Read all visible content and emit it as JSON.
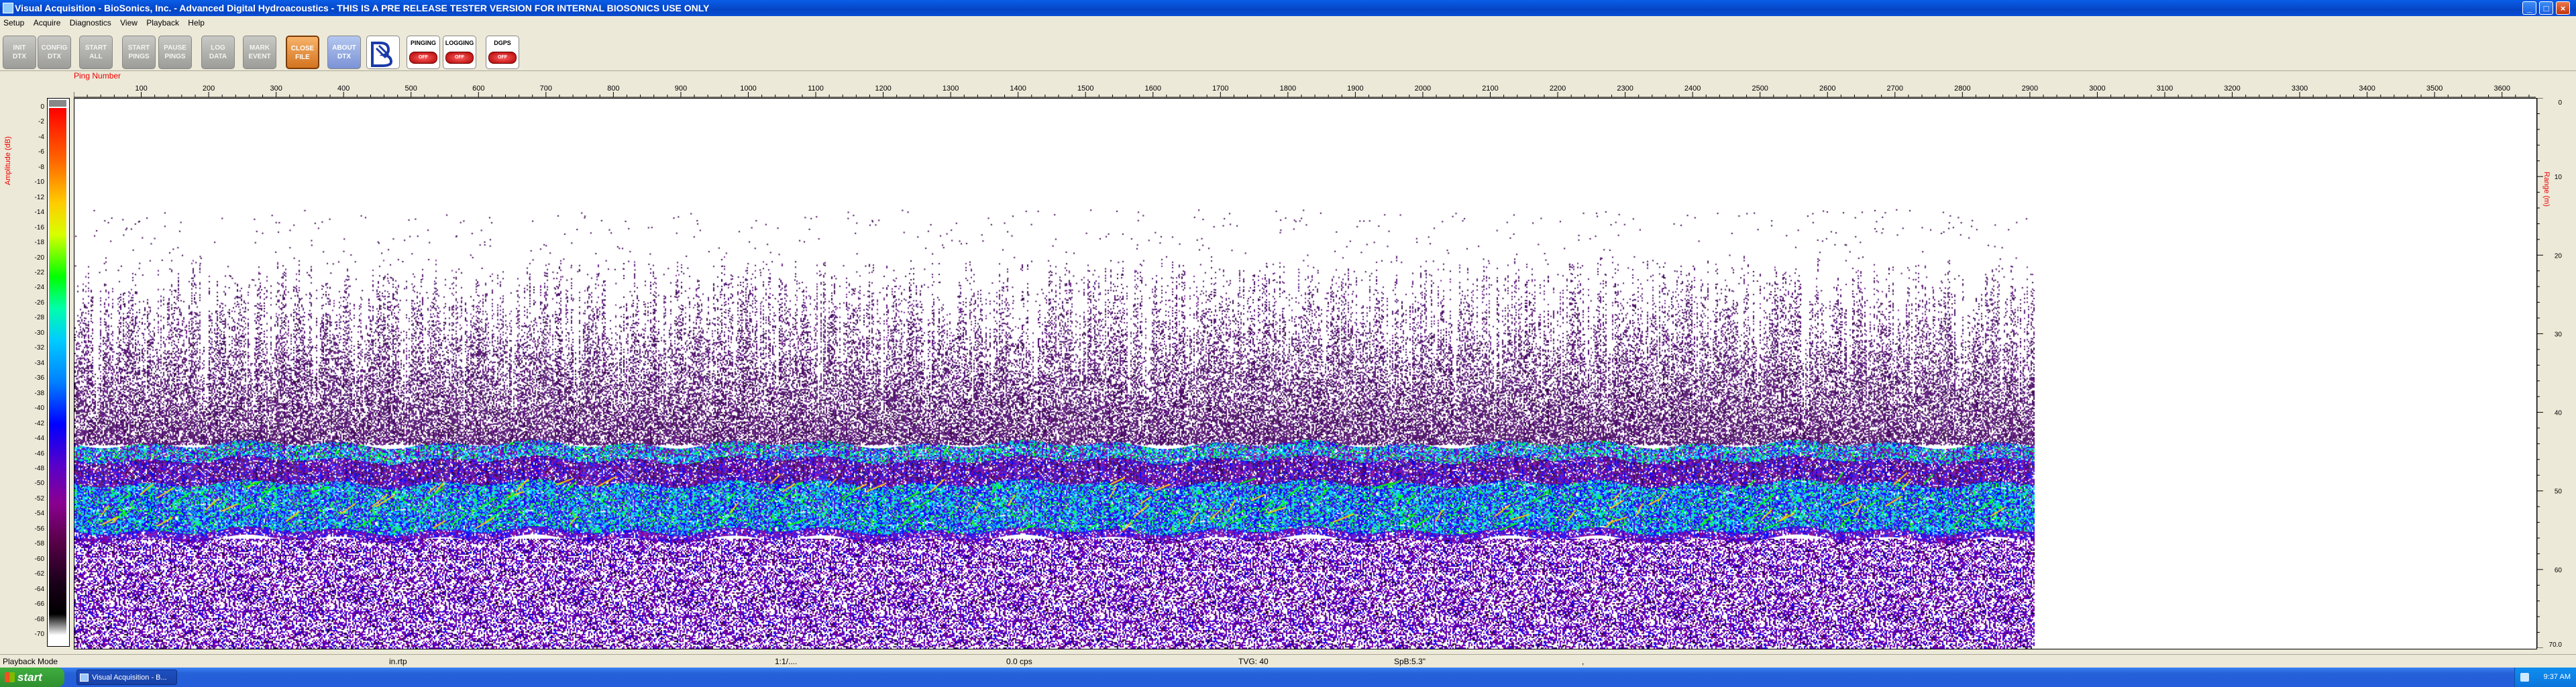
{
  "window": {
    "title": "Visual Acquisition  -  BioSonics, Inc.  -  Advanced Digital Hydroacoustics  -  THIS IS A PRE RELEASE TESTER VERSION FOR INTERNAL BIOSONICS USE ONLY",
    "minimize_icon": "minimize-icon",
    "maximize_icon": "maximize-icon",
    "close_icon": "close-icon"
  },
  "menu": [
    "Setup",
    "Acquire",
    "Diagnostics",
    "View",
    "Playback",
    "Help"
  ],
  "toolbar": {
    "buttons": [
      {
        "line1": "INIT",
        "line2": "DTX"
      },
      {
        "line1": "CONFIG",
        "line2": "DTX"
      },
      {
        "line1": "START",
        "line2": "ALL"
      },
      {
        "line1": "START",
        "line2": "PINGS"
      },
      {
        "line1": "PAUSE",
        "line2": "PINGS"
      },
      {
        "line1": "LOG",
        "line2": "DATA"
      },
      {
        "line1": "MARK",
        "line2": "EVENT"
      },
      {
        "line1": "CLOSE",
        "line2": "FILE"
      },
      {
        "line1": "ABOUT",
        "line2": "DTX"
      }
    ],
    "status": [
      {
        "label": "PINGING",
        "state": "OFF"
      },
      {
        "label": "LOGGING",
        "state": "OFF"
      },
      {
        "label": "DGPS",
        "state": "OFF"
      }
    ]
  },
  "echogram": {
    "amplitude_label": "Amplitude (dB)",
    "range_label": "Range (m)",
    "ping_label": "Ping Number",
    "amplitude_ticks": [
      "0",
      "-2",
      "-4",
      "-6",
      "-8",
      "-10",
      "-12",
      "-14",
      "-16",
      "-18",
      "-20",
      "-22",
      "-24",
      "-26",
      "-28",
      "-30",
      "-32",
      "-34",
      "-36",
      "-38",
      "-40",
      "-42",
      "-44",
      "-46",
      "-48",
      "-50",
      "-52",
      "-54",
      "-56",
      "-58",
      "-60",
      "-62",
      "-64",
      "-66",
      "-68",
      "-70"
    ],
    "ping_ticks": [
      "100",
      "200",
      "300",
      "400",
      "500",
      "600",
      "700",
      "800",
      "900",
      "1000",
      "1100",
      "1200",
      "1300",
      "1400",
      "1500",
      "1600",
      "1700",
      "1800",
      "1900",
      "2000",
      "2100",
      "2200",
      "2300",
      "2400",
      "2500",
      "2600",
      "2700",
      "2800",
      "2900",
      "3000",
      "3100",
      "3200",
      "3300",
      "3400",
      "3500",
      "3600"
    ],
    "range_ticks": [
      "0",
      "10",
      "20",
      "30",
      "40",
      "50",
      "60",
      "70.0"
    ],
    "data": {
      "ping_axis_max": 3650,
      "pings_recorded": 2905,
      "range_max_m": 70.0,
      "scatter_top_m": 20,
      "layer1_m": [
        44,
        46
      ],
      "layer2_m": [
        49,
        55
      ],
      "bottom_noise_from_m": 56,
      "colors": [
        "#ff0000",
        "#ffcc00",
        "#00ff00",
        "#00ccff",
        "#0000ff",
        "#5a00c8",
        "#8a0090",
        "#000000"
      ]
    }
  },
  "statusbar": {
    "mode": "Playback Mode",
    "file": "in.rtp",
    "time": "1:1/....",
    "speed": "0.0 cps",
    "tvg": "TVG: 40",
    "spb": "SpB:5.3\"",
    "extra": ","
  },
  "taskbar": {
    "start": "start",
    "task": "Visual Acquisition  -  B...",
    "clock": "9:37 AM"
  }
}
